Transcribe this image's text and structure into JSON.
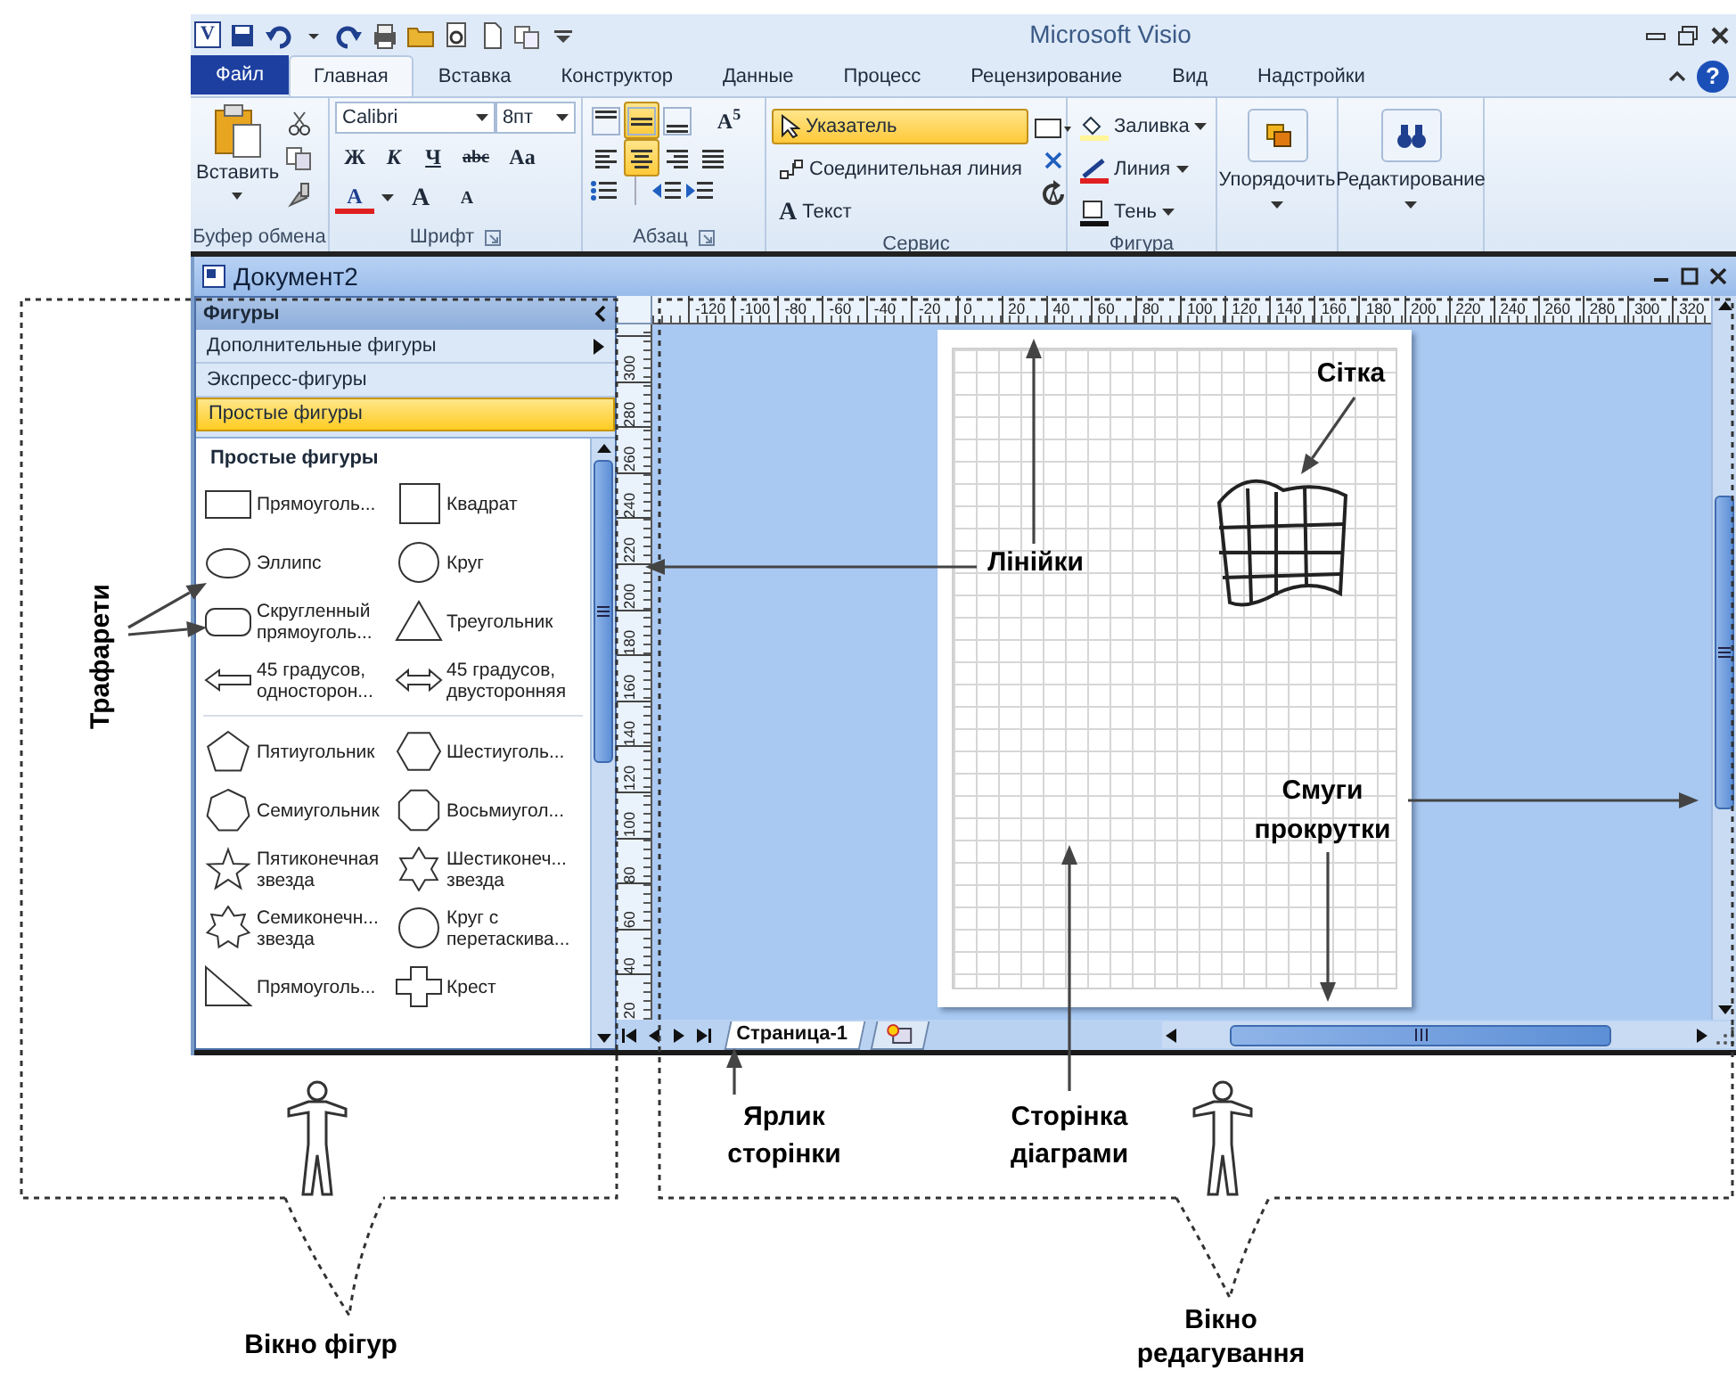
{
  "window": {
    "app_logo": "V",
    "title": "Microsoft Visio",
    "help": "?"
  },
  "file_tab": "Файл",
  "tabs": [
    {
      "label": "Главная",
      "selected": true
    },
    {
      "label": "Вставка",
      "selected": false
    },
    {
      "label": "Конструктор",
      "selected": false
    },
    {
      "label": "Данные",
      "selected": false
    },
    {
      "label": "Процесс",
      "selected": false
    },
    {
      "label": "Рецензирование",
      "selected": false
    },
    {
      "label": "Вид",
      "selected": false
    },
    {
      "label": "Надстройки",
      "selected": false
    }
  ],
  "ribbon": {
    "clipboard": {
      "label": "Буфер обмена",
      "paste": "Вставить"
    },
    "font": {
      "label": "Шрифт",
      "family": "Calibri",
      "size": "8пт",
      "styles": [
        "Ж",
        "К",
        "Ч",
        "abc",
        "Aa"
      ],
      "color_button": "A",
      "grow": "A",
      "shrink": "A"
    },
    "paragraph": {
      "label": "Абзац",
      "text_block": "A$^{5}$",
      "align_buttons": [
        {
          "kind": "top",
          "selected": false
        },
        {
          "kind": "middle",
          "selected": true
        },
        {
          "kind": "bottom",
          "selected": false
        },
        {
          "kind": "left",
          "selected": false
        },
        {
          "kind": "center",
          "selected": true
        },
        {
          "kind": "right",
          "selected": false
        },
        {
          "kind": "justify",
          "selected": false
        }
      ]
    },
    "tools": {
      "label": "Сервис",
      "items": [
        {
          "kind": "pointer",
          "label": "Указатель",
          "selected": true
        },
        {
          "kind": "connector",
          "label": "Соединительная линия",
          "selected": false
        },
        {
          "kind": "text",
          "glyph": "A",
          "label": "Текст",
          "selected": false
        }
      ]
    },
    "shape": {
      "label": "Фигура",
      "items": [
        {
          "kind": "fill",
          "label": "Заливка"
        },
        {
          "kind": "line",
          "label": "Линия"
        },
        {
          "kind": "shadow",
          "label": "Тень"
        }
      ]
    },
    "arrange": "Упорядочить",
    "editing": "Редактирование"
  },
  "document": {
    "title": "Документ2",
    "shapes_panel": {
      "title": "Фигуры",
      "menu": [
        {
          "label": "Дополнительные фигуры",
          "submenu": true,
          "selected": false
        },
        {
          "label": "Экспресс-фигуры",
          "submenu": false,
          "selected": false
        },
        {
          "label": "Простые фигуры",
          "submenu": false,
          "selected": true
        }
      ],
      "stencil_title": "Простые фигуры",
      "sections": [
        [
          {
            "kind": "rect",
            "label": "Прямоуголь..."
          },
          {
            "kind": "square",
            "label": "Квадрат"
          },
          {
            "kind": "ellipse",
            "label": "Эллипс"
          },
          {
            "kind": "circle",
            "label": "Круг"
          },
          {
            "kind": "roundrect",
            "label": "Скругленный прямоуголь..."
          },
          {
            "kind": "triangle",
            "label": "Треугольник"
          },
          {
            "kind": "arrow1",
            "label": "45 градусов, односторон..."
          },
          {
            "kind": "arrow2",
            "label": "45 градусов, двусторонняя"
          }
        ],
        [
          {
            "kind": "pentagon",
            "label": "Пятиугольник"
          },
          {
            "kind": "hexagon",
            "label": "Шестиуголь..."
          },
          {
            "kind": "heptagon",
            "label": "Семиугольник"
          },
          {
            "kind": "octagon",
            "label": "Восьмиугол..."
          },
          {
            "kind": "star5",
            "label": "Пятиконечная звезда"
          },
          {
            "kind": "star6",
            "label": "Шестиконеч... звезда"
          },
          {
            "kind": "star7",
            "label": "Семиконечн... звезда"
          },
          {
            "kind": "circle",
            "label": "Круг с перетаскива..."
          },
          {
            "kind": "rtriangle",
            "label": "Прямоуголь..."
          },
          {
            "kind": "cross",
            "label": "Крест"
          }
        ]
      ]
    },
    "top_ruler": [
      "-120",
      "-100",
      "-80",
      "-60",
      "-40",
      "-20",
      "0",
      "20",
      "40",
      "60",
      "80",
      "100",
      "120",
      "140",
      "160",
      "180",
      "200",
      "220",
      "240",
      "260",
      "280",
      "300",
      "320"
    ],
    "left_ruler": [
      "300",
      "280",
      "260",
      "240",
      "220",
      "200",
      "180",
      "160",
      "140",
      "120",
      "100",
      "80",
      "60",
      "40",
      "20"
    ],
    "page_tabs": [
      {
        "label": "Страница-1",
        "selected": true
      }
    ]
  },
  "annotations": [
    {
      "text": "Трафарети"
    },
    {
      "text": "Лінійки"
    },
    {
      "text": "Сітка"
    },
    {
      "text": "Смуги прокрутки"
    },
    {
      "text": "Ярлик сторінки"
    },
    {
      "text": "Сторінка діаграми"
    },
    {
      "text": "Вікно фігур"
    },
    {
      "text": "Вікно редагування"
    }
  ]
}
